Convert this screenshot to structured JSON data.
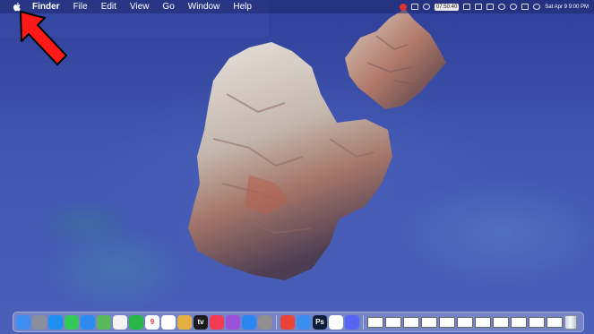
{
  "menubar": {
    "items": [
      "Finder",
      "File",
      "Edit",
      "View",
      "Go",
      "Window",
      "Help"
    ],
    "clock_badge": "07:50:40",
    "datetime": "Sat Apr 9 9:00 PM"
  },
  "dock": {
    "apps": [
      {
        "name": "finder",
        "color": "#3d8ef0"
      },
      {
        "name": "launchpad",
        "color": "#8a8f9c"
      },
      {
        "name": "safari",
        "color": "#1f8ff0"
      },
      {
        "name": "messages",
        "color": "#34c85a"
      },
      {
        "name": "mail",
        "color": "#2d8af0"
      },
      {
        "name": "maps",
        "color": "#5ab85a"
      },
      {
        "name": "photos",
        "color": "#f2f2f2"
      },
      {
        "name": "facetime",
        "color": "#28b84a"
      },
      {
        "name": "calendar",
        "color": "#ffffff",
        "label": "9"
      },
      {
        "name": "reminders",
        "color": "#ffffff"
      },
      {
        "name": "notes",
        "color": "#e0b040"
      },
      {
        "name": "apple-tv",
        "color": "#1c1c1e",
        "label": "tv"
      },
      {
        "name": "music",
        "color": "#f23a52"
      },
      {
        "name": "podcasts",
        "color": "#9c4fd8"
      },
      {
        "name": "app-store",
        "color": "#2a86f0"
      },
      {
        "name": "settings",
        "color": "#8e8e93"
      },
      {
        "name": "chrome",
        "color": "#ea4335"
      },
      {
        "name": "cloud-app",
        "color": "#3c8df0"
      },
      {
        "name": "photoshop",
        "color": "#0a1e3c",
        "label": "Ps"
      },
      {
        "name": "slack",
        "color": "#ffffff"
      },
      {
        "name": "discord",
        "color": "#5865f2"
      }
    ],
    "window_count": 11
  }
}
